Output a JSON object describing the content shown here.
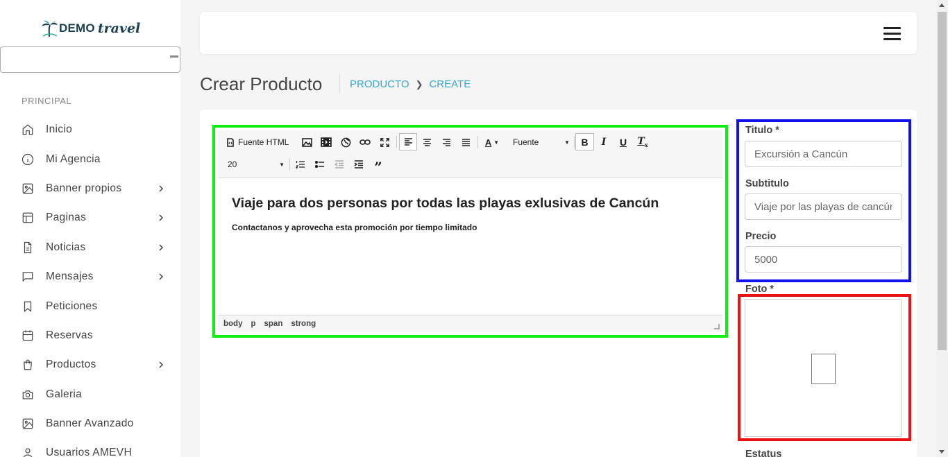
{
  "brand": {
    "demo": "DEMO",
    "travel": "travel"
  },
  "sidebar": {
    "header": "PRINCIPAL",
    "items": [
      {
        "label": "Inicio",
        "icon": "home-icon",
        "has_submenu": false
      },
      {
        "label": "Mi Agencia",
        "icon": "info-icon",
        "has_submenu": false
      },
      {
        "label": "Banner propios",
        "icon": "image-icon",
        "has_submenu": true
      },
      {
        "label": "Paginas",
        "icon": "layout-icon",
        "has_submenu": true
      },
      {
        "label": "Noticias",
        "icon": "file-text-icon",
        "has_submenu": true
      },
      {
        "label": "Mensajes",
        "icon": "message-icon",
        "has_submenu": true
      },
      {
        "label": "Peticiones",
        "icon": "bookmark-icon",
        "has_submenu": false
      },
      {
        "label": "Reservas",
        "icon": "calendar-icon",
        "has_submenu": false
      },
      {
        "label": "Productos",
        "icon": "shopping-bag-icon",
        "has_submenu": true
      },
      {
        "label": "Galeria",
        "icon": "camera-icon",
        "has_submenu": false
      },
      {
        "label": "Banner Avanzado",
        "icon": "image-icon",
        "has_submenu": false
      },
      {
        "label": "Usuarios AMEVH",
        "icon": "user-icon",
        "has_submenu": false
      }
    ]
  },
  "page": {
    "title": "Crear Producto",
    "breadcrumb": [
      "PRODUCTO",
      "CREATE"
    ]
  },
  "editor": {
    "toolbar": {
      "source_label": "Fuente HTML",
      "font_label": "Fuente",
      "size_label": "20"
    },
    "content": {
      "heading": "Viaje para dos personas por todas las playas exlusivas de Cancún",
      "paragraph": "Contactanos y aprovecha esta promoción por tiempo limitado"
    },
    "path": [
      "body",
      "p",
      "span",
      "strong"
    ]
  },
  "form": {
    "titulo": {
      "label": "Titulo *",
      "value": "Excursión a Cancún"
    },
    "subtitulo": {
      "label": "Subtitulo",
      "value": "Viaje por las playas de cancún"
    },
    "precio": {
      "label": "Precio",
      "value": "5000"
    },
    "foto": {
      "label": "Foto *"
    },
    "estatus": {
      "label": "Estatus"
    }
  },
  "colors": {
    "accent": "#3aa6c9",
    "editor_highlight": "#11ee11",
    "fields_highlight": "#1111ee",
    "photo_highlight": "#ee1111"
  }
}
